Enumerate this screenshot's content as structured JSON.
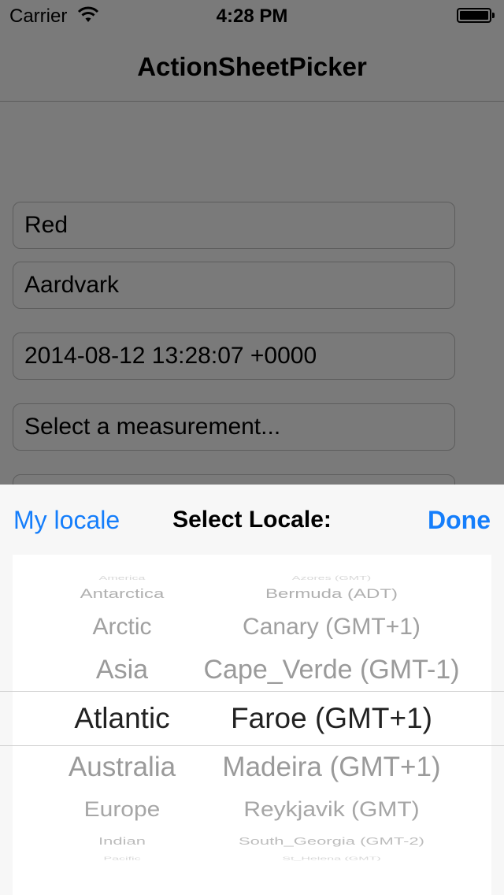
{
  "status_bar": {
    "carrier": "Carrier",
    "time": "4:28 PM",
    "wifi_icon": "wifi-icon",
    "battery_level": 1.0
  },
  "nav": {
    "title": "ActionSheetPicker"
  },
  "fields": [
    {
      "value": "Red"
    },
    {
      "value": "Aardvark"
    },
    {
      "value": "2014-08-12 13:28:07 +0000"
    },
    {
      "value": "Select a measurement..."
    },
    {
      "value": ""
    }
  ],
  "sheet": {
    "left_button": "My locale",
    "title": "Select Locale:",
    "right_button": "Done",
    "accent_color": "#157efb",
    "picker": {
      "rows": [
        {
          "region": "America",
          "locale": "Azores (GMT)"
        },
        {
          "region": "Antarctica",
          "locale": "Bermuda (ADT)"
        },
        {
          "region": "Arctic",
          "locale": "Canary (GMT+1)"
        },
        {
          "region": "Asia",
          "locale": "Cape_Verde (GMT-1)"
        },
        {
          "region": "Atlantic",
          "locale": "Faroe (GMT+1)"
        },
        {
          "region": "Australia",
          "locale": "Madeira (GMT+1)"
        },
        {
          "region": "Europe",
          "locale": "Reykjavik (GMT)"
        },
        {
          "region": "Indian",
          "locale": "South_Georgia (GMT-2)"
        },
        {
          "region": "Pacific",
          "locale": "St_Helena (GMT)"
        }
      ],
      "selected_index": 4
    }
  }
}
